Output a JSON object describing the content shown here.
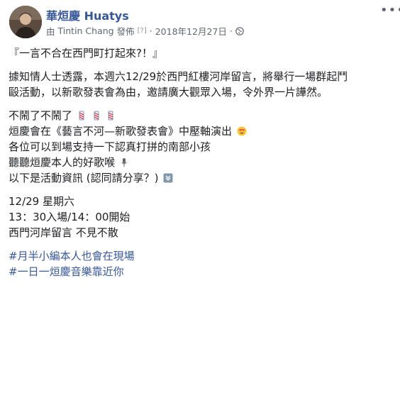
{
  "post": {
    "author_name": "華烜慶 Huatys",
    "posted_by_prefix": "由",
    "posted_by_name": "Tintin Chang",
    "posted_by_suffix": "發佈",
    "help_tag": "[?]",
    "separator": "·",
    "date": "2018年12月27日",
    "more_label": "•••",
    "lines": {
      "title": "『一言不合在西門町打起來?！』",
      "p1a": "據知情人士透露，本週六12/29於西門紅樓河岸留言，將舉行一場群起鬥",
      "p1b": "毆活動，以新歌發表會為由，邀請廣大觀眾入場，令外界一片譁然。",
      "p2a": "不鬧了不鬧了",
      "p2b": "烜慶會在《藝言不河—新歌發表會》中壓軸演出",
      "p2c": "各位可以到場支持一下認真打拼的南部小孩",
      "p2d": "聽聽烜慶本人的好歌喉",
      "p2e": "以下是活動資訊 (認同請分享？)",
      "p3a": "12/29 星期六",
      "p3b": "13：30入場/14：00開始",
      "p3c": "西門河岸留言 不見不散",
      "tag1": "#月半小編本人也會在現場",
      "tag2": "#一日一烜慶音樂靠近你"
    }
  },
  "icons": {
    "barber": "barber-pole-icon",
    "heart_eyes": "heart-eyes-emoji-icon",
    "mic": "microphone-icon",
    "down": "down-arrow-button-icon",
    "globe": "globe-icon"
  }
}
